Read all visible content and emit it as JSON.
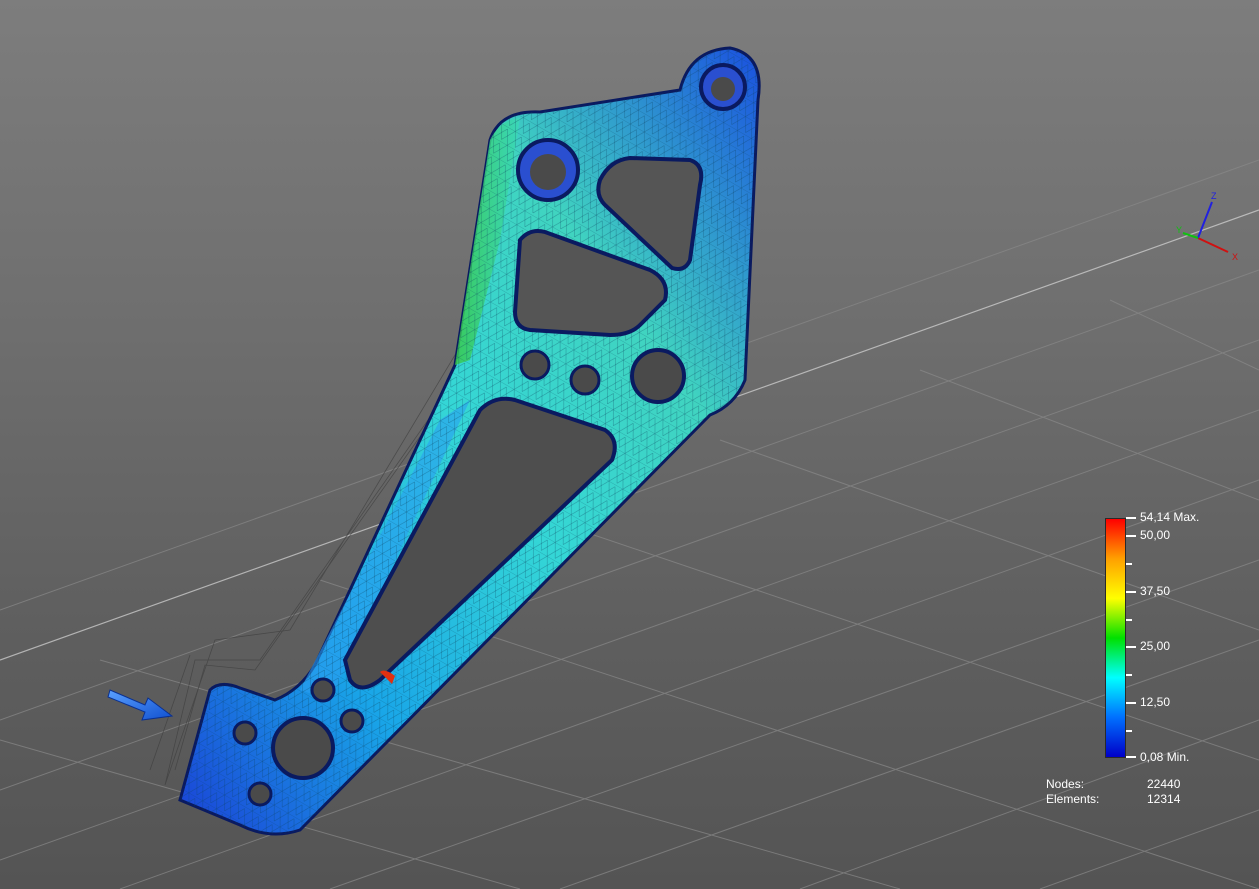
{
  "legend": {
    "max_label": "54,14 Max.",
    "min_label": "0,08 Min.",
    "ticks": [
      "50,00",
      "37,50",
      "25,00",
      "12,50"
    ],
    "gradient_colors": [
      "#ff0000",
      "#ffa000",
      "#ffff00",
      "#00e000",
      "#00ffff",
      "#0070ff",
      "#0000c8"
    ]
  },
  "stats": {
    "nodes_label": "Nodes:",
    "nodes_value": "22440",
    "elements_label": "Elements:",
    "elements_value": "12314"
  },
  "axes": {
    "x_label": "X",
    "y_label": "Y",
    "z_label": "Z",
    "x_color": "#d01010",
    "y_color": "#10c010",
    "z_color": "#2020e0"
  },
  "load_arrow_icon": "blue-arrow-icon"
}
